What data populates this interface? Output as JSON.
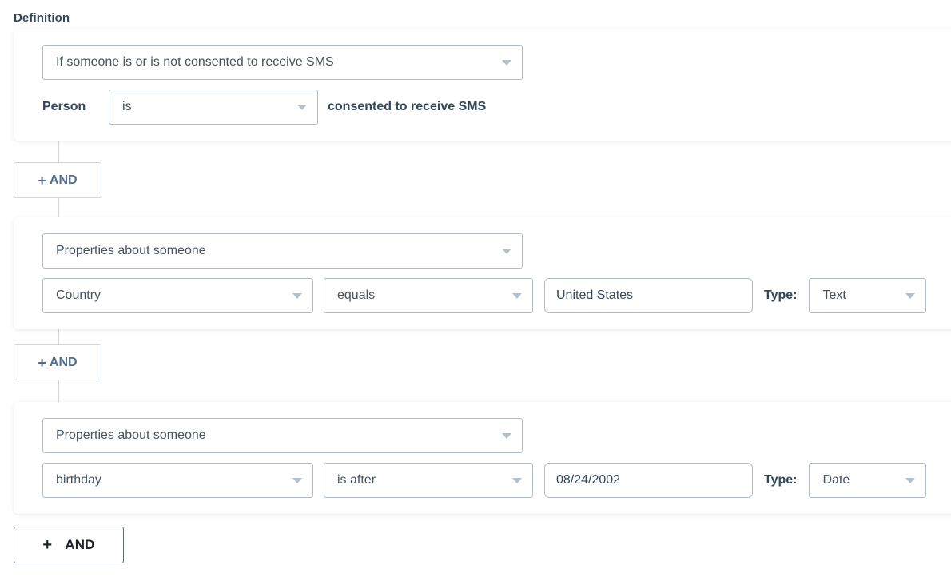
{
  "page": {
    "definition_label": "Definition"
  },
  "filters": [
    {
      "id": "filter-sms-consent",
      "type_select": {
        "name": "filter-type-select",
        "value": "If someone is or is not consented to receive SMS",
        "caret_icon": "chevron-down-icon"
      },
      "detail_row": {
        "prefix_label": "Person",
        "operator_select": {
          "name": "sms-consent-operator-select",
          "value": "is",
          "caret_icon": "chevron-down-icon"
        },
        "suffix_label": "consented to receive SMS"
      }
    },
    {
      "id": "filter-country",
      "type_select": {
        "name": "filter-type-select",
        "value": "Properties about someone",
        "caret_icon": "chevron-down-icon"
      },
      "detail_row": {
        "property_select": {
          "name": "property-select",
          "value": "Country",
          "caret_icon": "chevron-down-icon"
        },
        "operator_select": {
          "name": "operator-select",
          "value": "equals",
          "caret_icon": "chevron-down-icon"
        },
        "value_input": {
          "name": "filter-value-input",
          "value": "United States",
          "placeholder": ""
        },
        "type_label": "Type:",
        "data_type_select": {
          "name": "data-type-select",
          "value": "Text",
          "caret_icon": "chevron-down-icon"
        }
      }
    },
    {
      "id": "filter-birthday",
      "type_select": {
        "name": "filter-type-select",
        "value": "Properties about someone",
        "caret_icon": "chevron-down-icon"
      },
      "detail_row": {
        "property_select": {
          "name": "property-select",
          "value": "birthday",
          "caret_icon": "chevron-down-icon"
        },
        "operator_select": {
          "name": "operator-select",
          "value": "is after",
          "caret_icon": "chevron-down-icon"
        },
        "value_input": {
          "name": "filter-value-input",
          "value": "08/24/2002",
          "placeholder": ""
        },
        "type_label": "Type:",
        "data_type_select": {
          "name": "data-type-select",
          "value": "Date",
          "caret_icon": "chevron-down-icon"
        }
      }
    }
  ],
  "and_buttons": {
    "plus_glyph": "+",
    "label": "AND"
  },
  "and_button_final": {
    "plus_glyph": "+",
    "label": "AND"
  },
  "colors": {
    "text_primary": "#33475b",
    "text_secondary": "#46535e",
    "border": "#b0bdc9",
    "border_light": "#cbd6e2",
    "and_button_text": "#506e91",
    "caret": "#b3bfcb",
    "background": "#ffffff"
  }
}
